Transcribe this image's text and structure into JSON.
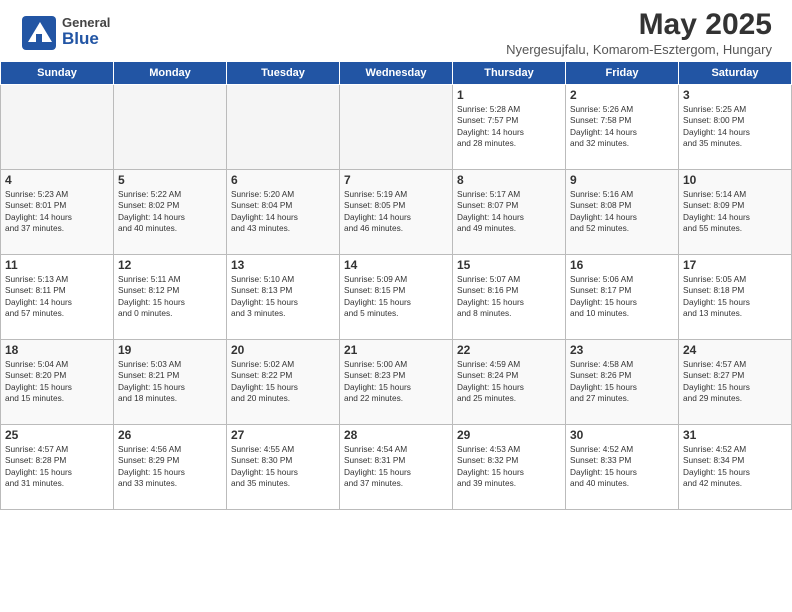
{
  "logo": {
    "general": "General",
    "blue": "Blue"
  },
  "title": "May 2025",
  "location": "Nyergesujfalu, Komarom-Esztergom, Hungary",
  "headers": [
    "Sunday",
    "Monday",
    "Tuesday",
    "Wednesday",
    "Thursday",
    "Friday",
    "Saturday"
  ],
  "weeks": [
    [
      {
        "day": "",
        "empty": true
      },
      {
        "day": "",
        "empty": true
      },
      {
        "day": "",
        "empty": true
      },
      {
        "day": "",
        "empty": true
      },
      {
        "day": "1",
        "info": "Sunrise: 5:28 AM\nSunset: 7:57 PM\nDaylight: 14 hours\nand 28 minutes."
      },
      {
        "day": "2",
        "info": "Sunrise: 5:26 AM\nSunset: 7:58 PM\nDaylight: 14 hours\nand 32 minutes."
      },
      {
        "day": "3",
        "info": "Sunrise: 5:25 AM\nSunset: 8:00 PM\nDaylight: 14 hours\nand 35 minutes."
      }
    ],
    [
      {
        "day": "4",
        "info": "Sunrise: 5:23 AM\nSunset: 8:01 PM\nDaylight: 14 hours\nand 37 minutes."
      },
      {
        "day": "5",
        "info": "Sunrise: 5:22 AM\nSunset: 8:02 PM\nDaylight: 14 hours\nand 40 minutes."
      },
      {
        "day": "6",
        "info": "Sunrise: 5:20 AM\nSunset: 8:04 PM\nDaylight: 14 hours\nand 43 minutes."
      },
      {
        "day": "7",
        "info": "Sunrise: 5:19 AM\nSunset: 8:05 PM\nDaylight: 14 hours\nand 46 minutes."
      },
      {
        "day": "8",
        "info": "Sunrise: 5:17 AM\nSunset: 8:07 PM\nDaylight: 14 hours\nand 49 minutes."
      },
      {
        "day": "9",
        "info": "Sunrise: 5:16 AM\nSunset: 8:08 PM\nDaylight: 14 hours\nand 52 minutes."
      },
      {
        "day": "10",
        "info": "Sunrise: 5:14 AM\nSunset: 8:09 PM\nDaylight: 14 hours\nand 55 minutes."
      }
    ],
    [
      {
        "day": "11",
        "info": "Sunrise: 5:13 AM\nSunset: 8:11 PM\nDaylight: 14 hours\nand 57 minutes."
      },
      {
        "day": "12",
        "info": "Sunrise: 5:11 AM\nSunset: 8:12 PM\nDaylight: 15 hours\nand 0 minutes."
      },
      {
        "day": "13",
        "info": "Sunrise: 5:10 AM\nSunset: 8:13 PM\nDaylight: 15 hours\nand 3 minutes."
      },
      {
        "day": "14",
        "info": "Sunrise: 5:09 AM\nSunset: 8:15 PM\nDaylight: 15 hours\nand 5 minutes."
      },
      {
        "day": "15",
        "info": "Sunrise: 5:07 AM\nSunset: 8:16 PM\nDaylight: 15 hours\nand 8 minutes."
      },
      {
        "day": "16",
        "info": "Sunrise: 5:06 AM\nSunset: 8:17 PM\nDaylight: 15 hours\nand 10 minutes."
      },
      {
        "day": "17",
        "info": "Sunrise: 5:05 AM\nSunset: 8:18 PM\nDaylight: 15 hours\nand 13 minutes."
      }
    ],
    [
      {
        "day": "18",
        "info": "Sunrise: 5:04 AM\nSunset: 8:20 PM\nDaylight: 15 hours\nand 15 minutes."
      },
      {
        "day": "19",
        "info": "Sunrise: 5:03 AM\nSunset: 8:21 PM\nDaylight: 15 hours\nand 18 minutes."
      },
      {
        "day": "20",
        "info": "Sunrise: 5:02 AM\nSunset: 8:22 PM\nDaylight: 15 hours\nand 20 minutes."
      },
      {
        "day": "21",
        "info": "Sunrise: 5:00 AM\nSunset: 8:23 PM\nDaylight: 15 hours\nand 22 minutes."
      },
      {
        "day": "22",
        "info": "Sunrise: 4:59 AM\nSunset: 8:24 PM\nDaylight: 15 hours\nand 25 minutes."
      },
      {
        "day": "23",
        "info": "Sunrise: 4:58 AM\nSunset: 8:26 PM\nDaylight: 15 hours\nand 27 minutes."
      },
      {
        "day": "24",
        "info": "Sunrise: 4:57 AM\nSunset: 8:27 PM\nDaylight: 15 hours\nand 29 minutes."
      }
    ],
    [
      {
        "day": "25",
        "info": "Sunrise: 4:57 AM\nSunset: 8:28 PM\nDaylight: 15 hours\nand 31 minutes."
      },
      {
        "day": "26",
        "info": "Sunrise: 4:56 AM\nSunset: 8:29 PM\nDaylight: 15 hours\nand 33 minutes."
      },
      {
        "day": "27",
        "info": "Sunrise: 4:55 AM\nSunset: 8:30 PM\nDaylight: 15 hours\nand 35 minutes."
      },
      {
        "day": "28",
        "info": "Sunrise: 4:54 AM\nSunset: 8:31 PM\nDaylight: 15 hours\nand 37 minutes."
      },
      {
        "day": "29",
        "info": "Sunrise: 4:53 AM\nSunset: 8:32 PM\nDaylight: 15 hours\nand 39 minutes."
      },
      {
        "day": "30",
        "info": "Sunrise: 4:52 AM\nSunset: 8:33 PM\nDaylight: 15 hours\nand 40 minutes."
      },
      {
        "day": "31",
        "info": "Sunrise: 4:52 AM\nSunset: 8:34 PM\nDaylight: 15 hours\nand 42 minutes."
      }
    ]
  ]
}
